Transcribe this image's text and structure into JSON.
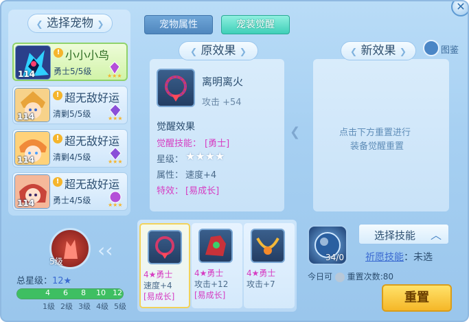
{
  "left": {
    "title": "选择宠物",
    "pets": [
      {
        "name": "小小小鸟",
        "sub": "勇士5/5级",
        "level": "114",
        "selected": true
      },
      {
        "name": "超无敌好运",
        "sub": "清剿5/5级",
        "level": "114",
        "selected": false
      },
      {
        "name": "超无敌好运",
        "sub": "清剿4/5级",
        "level": "114",
        "selected": false
      },
      {
        "name": "超无敌好运",
        "sub": "勇士4/5级",
        "level": "114",
        "selected": false
      }
    ]
  },
  "tabs": {
    "attr": "宠物属性",
    "awaken": "宠装觉醒"
  },
  "original": {
    "title": "原效果",
    "item_name": "离明离火",
    "item_stat": "攻击 +54",
    "section_title": "觉醒效果",
    "skill_label": "觉醒技能：",
    "skill_value": "[勇士]",
    "star_label": "星级：",
    "stars": "★★★★",
    "attr_label": "属性：",
    "attr_value": "速度+4",
    "effect_label": "特效：",
    "effect_value": "[易成长]"
  },
  "new_effect": {
    "title": "新效果",
    "hint_line1": "点击下方重置进行",
    "hint_line2": "装备觉醒重置",
    "book_label": "图鉴"
  },
  "summary": {
    "level_badge": "5级",
    "total_stars_label": "总星级：",
    "total_stars_value": "12★",
    "progress_ticks": [
      "4",
      "6",
      "8",
      "10",
      "12"
    ],
    "level_labels": [
      "1级",
      "2级",
      "3级",
      "4级",
      "5级"
    ],
    "progress_fraction": 1.0
  },
  "cards": [
    {
      "line1": "4★勇士",
      "line2": "速度+4",
      "line3": "[易成长]",
      "selected": true
    },
    {
      "line1": "4★勇士",
      "line2": "攻击+12",
      "line3": "[易成长]",
      "selected": false
    },
    {
      "line1": "4★勇士",
      "line2": "攻击+7",
      "line3": "",
      "selected": false
    }
  ],
  "right": {
    "orb_count": "34/0",
    "select_skill_label": "选择技能",
    "wish_label": "祈愿技能",
    "wish_value": "：未选",
    "today_label": "今日可",
    "reset_count_label": "重置次数",
    "reset_count_value": ":80",
    "reset_button": "重置"
  },
  "colors": {
    "accent_green": "#d1f3a8",
    "magenta": "#d63cc2",
    "button_gold": "#f5b728"
  }
}
